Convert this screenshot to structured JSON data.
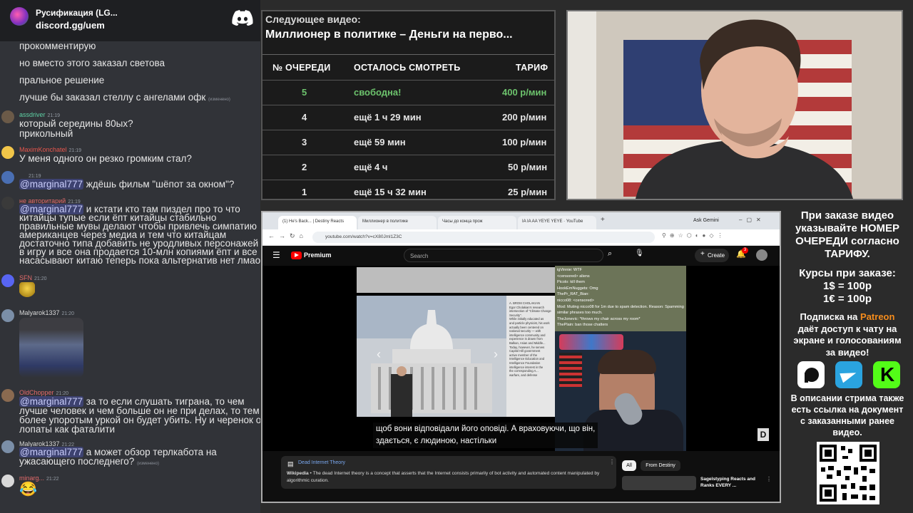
{
  "chat": {
    "server_name": "Русификация (LG...",
    "server_link": "discord.gg/uem",
    "messages": [
      {
        "text": "прокомментирую"
      },
      {
        "text": "но вместо этого заказал светова"
      },
      {
        "text": "пральное решение"
      },
      {
        "text": "лучше бы заказал стеллу с ангелами офк",
        "edited": "(изменено)"
      },
      {
        "author": "assdriver",
        "time": "21:19",
        "lines": [
          "который середины 80ых?",
          "прикольный"
        ]
      },
      {
        "author": "MaximKonchatel",
        "time": "21:19",
        "lines": [
          "У меня одного он резко громким стал?"
        ]
      },
      {
        "author": "",
        "time": "21:19",
        "mention": "@marginal777",
        "lines": [
          " ждёшь фильм \"шёпот за окном\"?"
        ]
      },
      {
        "author": "не авторитарий",
        "time": "21:19",
        "mention": "@marginal777",
        "lines": [
          " и кстати кто там пиздел про то что",
          "китайцы тупые если ёпт китайцы стабильно",
          "правильные мувы делают чтобы привлечь симпатию",
          "американцев через медиа и тем что китайцам",
          "достаточно типа добавить не уродливых персонажей",
          "в игру и все она продается 10-млн копиями ёпт и все",
          "насасывают китаю теперь пока альтернатив нет лмао"
        ]
      },
      {
        "author": "SFN",
        "time": "21:20"
      },
      {
        "author": "Malyarok1337",
        "time": "21:20"
      },
      {
        "author": "OldChopper",
        "time": "21:20",
        "mention": "@marginal777",
        "lines": [
          " за то если слушать тиграна, то чем",
          "лучше человек и чем больше он не при делах, то тем",
          "более упоротым уркой он будет убить. Ну и черенок от",
          "лопаты как фаталити"
        ]
      },
      {
        "author": "Malyarok1337",
        "time": "21:22",
        "mention": "@marginal777",
        "lines": [
          " а может обзор терлкабота на",
          "ужасающего последнего?"
        ],
        "edited": "(изменено)"
      },
      {
        "author": "minarg...",
        "time": "21:22"
      }
    ]
  },
  "queue": {
    "next_label": "Следующее видео:",
    "next_title": "Миллионер в политике – Деньги на перво...",
    "headers": [
      "№ ОЧЕРЕДИ",
      "ОСТАЛОСЬ СМОТРЕТЬ",
      "ТАРИФ"
    ],
    "rows": [
      {
        "num": "5",
        "remaining": "свободна!",
        "tariff": "400 р/мин",
        "free": true
      },
      {
        "num": "4",
        "remaining": "ещё 1 ч 29 мин",
        "tariff": "200 р/мин"
      },
      {
        "num": "3",
        "remaining": "ещё 59 мин",
        "tariff": "100 р/мин"
      },
      {
        "num": "2",
        "remaining": "ещё 4 ч",
        "tariff": "50 р/мин"
      },
      {
        "num": "1",
        "remaining": "ещё 15 ч 32 мин",
        "tariff": "25 р/мин"
      }
    ]
  },
  "browser": {
    "tabs": [
      "(1) He's Back... | Destiny Reacts",
      "Миллионер в политике",
      "Часы до конца прож",
      "IA IA AA YEYE YEYE · YouTube"
    ],
    "ask_gemini": "Ask Gemini",
    "url": "youtube.com/watch?v=cX80Jml1Z3C",
    "yt_brand": "Premium",
    "search_placeholder": "Search",
    "create_label": "Create",
    "notif_count": "3",
    "subtitle_lines": [
      "щоб вони відповідали його оповіді.  А враховуючи, що він,",
      "здається, є людиною, настільки"
    ],
    "chat_overlay": [
      "igVinnie: WTF",
      "<censored> aliens",
      "Picolo: kill them",
      "HookEmNuggets: Omg",
      "ThePr_RAT_Bian:",
      "nicco08: <censored>",
      "Mod: Muting nicco08 for 1m due to spam detection. Reason: Spamming similar phrases too much.",
      "TheJonevic: *throws my chair across my room*",
      "ThePlain: ban those chatters"
    ],
    "wiki_title": "Dead Internet Theory",
    "wiki_source": "Wikipedia",
    "wiki_text": " • The dead Internet theory is a concept that asserts that the Internet consists primarily of bot activity and automated content manipulated by algorithmic curation.",
    "filter_all": "All",
    "filter_destiny": "From Destiny",
    "rec_title": "Sagelstyping Reacts and Ranks EVERY ...",
    "doc_text": [
      "A. BROM CHOLAKIAN",
      "Egor Cholakian's research",
      "intersection of \"Climate Change",
      "Security\".",
      "While initially educated as",
      "and particle physicist, his work",
      "actually been centered on",
      "national security — with",
      "intelligence community and",
      "experience is drawn from",
      "Balkan, Asian and Middle...",
      "Today, however, he serves",
      "Capitol Hill government",
      "active member of the",
      "Intelligence Education and",
      "Intelligence Foundation",
      "intelligence interest in the",
      "the corresponding A...",
      "warfare, and defense"
    ]
  },
  "info": {
    "order_lines": [
      "При заказе видео",
      "указывайте НОМЕР",
      "ОЧЕРЕДИ согласно",
      "ТАРИФУ."
    ],
    "rates_lines": [
      "Курсы при заказе:",
      "1$ = 100р",
      "1€ = 100р"
    ],
    "sub_pre": "Подписка на ",
    "patreon": "Patreon",
    "sub_lines": [
      "даёт доступ к чату на",
      "экране и голосованиям",
      "за видео!"
    ],
    "desc_lines": [
      "В описании стрима также",
      "есть ссылка на документ",
      "с заказанными ранее",
      "видео."
    ]
  },
  "colors": {
    "free_green": "#6dc36d",
    "patreon_orange": "#f58c1c",
    "mention_bg": "#3d4270",
    "telegram_blue": "#2aa3df",
    "kick_green": "#53fc18"
  }
}
